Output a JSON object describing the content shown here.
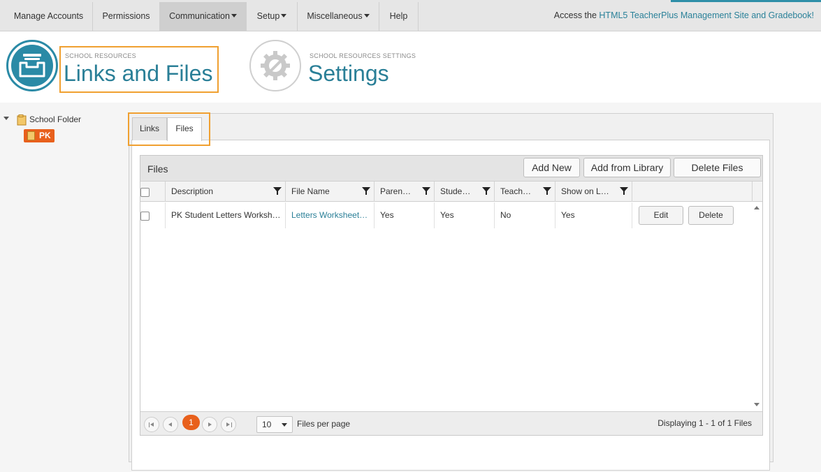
{
  "nav": {
    "items": [
      {
        "label": "Manage Accounts",
        "dropdown": false
      },
      {
        "label": "Permissions",
        "dropdown": false
      },
      {
        "label": "Communication",
        "dropdown": true,
        "active": true
      },
      {
        "label": "Setup",
        "dropdown": true
      },
      {
        "label": "Miscellaneous",
        "dropdown": true
      },
      {
        "label": "Help",
        "dropdown": false
      }
    ],
    "access_prefix": "Access the ",
    "access_link": "HTML5 TeacherPlus Management Site and Gradebook!"
  },
  "header": {
    "links_small": "SCHOOL RESOURCES",
    "links_title": "Links and Files",
    "settings_small": "SCHOOL RESOURCES SETTINGS",
    "settings_title": "Settings"
  },
  "tree": {
    "root_label": "School Folder",
    "child_label": "PK"
  },
  "tabs": {
    "links": "Links",
    "files": "Files"
  },
  "grid": {
    "title": "Files",
    "buttons": {
      "add_new": "Add New",
      "add_from_library": "Add from Library",
      "delete_files": "Delete Files"
    },
    "columns": [
      "Description",
      "File Name",
      "Paren…",
      "Stude…",
      "Teach…",
      "Show on L…"
    ],
    "rows": [
      {
        "description": "PK Student Letters Worksh…",
        "file_name": "Letters Worksheet…",
        "parent": "Yes",
        "student": "Yes",
        "teacher": "No",
        "show_on": "Yes",
        "edit": "Edit",
        "delete": "Delete"
      }
    ],
    "pager": {
      "current_page": "1",
      "per_page": "10",
      "per_page_label": "Files per page",
      "info": "Displaying 1 - 1 of 1 Files"
    }
  },
  "colors": {
    "accent": "#2a7f97",
    "highlight": "#f0a030",
    "pager_active": "#e8601c"
  }
}
